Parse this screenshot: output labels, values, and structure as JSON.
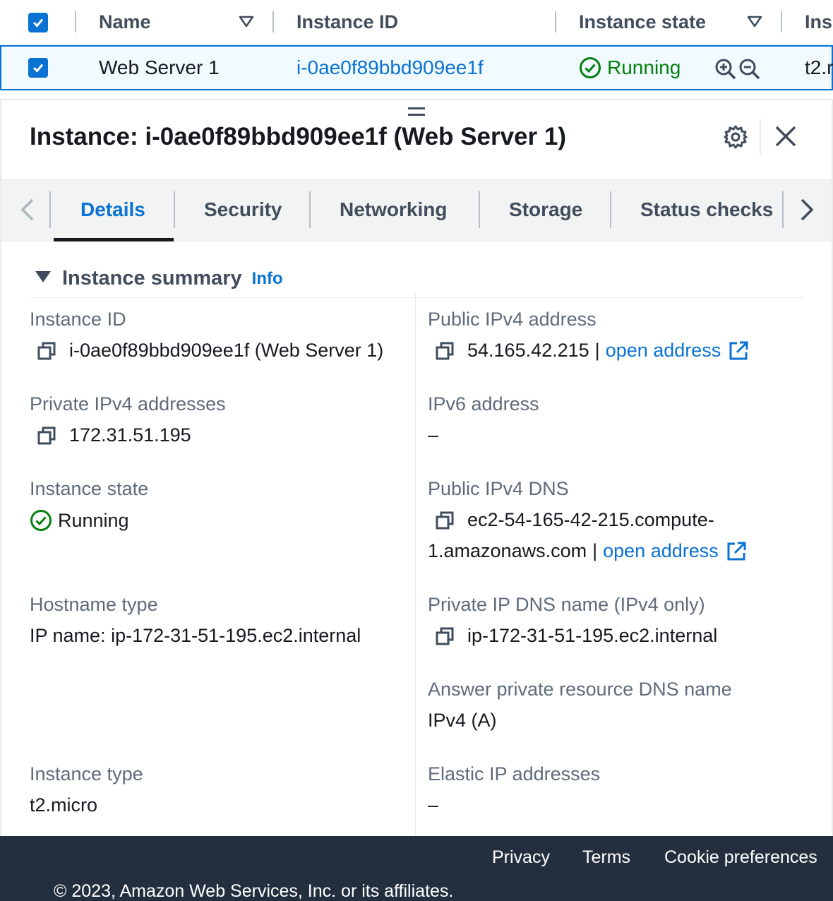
{
  "table": {
    "headers": {
      "name": "Name",
      "instance_id": "Instance ID",
      "instance_state": "Instance state",
      "instance_type_partial": "Ins"
    },
    "row": {
      "name": "Web Server 1",
      "instance_id": "i-0ae0f89bbd909ee1f",
      "state": "Running",
      "type_partial": "t2.r"
    }
  },
  "panel": {
    "title": "Instance: i-0ae0f89bbd909ee1f (Web Server 1)",
    "tabs": [
      "Details",
      "Security",
      "Networking",
      "Storage",
      "Status checks"
    ],
    "active_tab": "Details",
    "section": {
      "title": "Instance summary",
      "info": "Info"
    },
    "fields": {
      "instance_id": {
        "label": "Instance ID",
        "value": "i-0ae0f89bbd909ee1f (Web Server 1)"
      },
      "public_ipv4": {
        "label": "Public IPv4 address",
        "value": "54.165.42.215",
        "sep": "|",
        "link": "open address"
      },
      "private_ipv4": {
        "label": "Private IPv4 addresses",
        "value": "172.31.51.195"
      },
      "ipv6": {
        "label": "IPv6 address",
        "value": "–"
      },
      "instance_state": {
        "label": "Instance state",
        "value": "Running"
      },
      "public_dns": {
        "label": "Public IPv4 DNS",
        "value_line1": "ec2-54-165-42-215.compute-",
        "value_line2": "1.amazonaws.com",
        "sep": "|",
        "link": "open address"
      },
      "hostname_type": {
        "label": "Hostname type",
        "value": "IP name: ip-172-31-51-195.ec2.internal"
      },
      "private_dns": {
        "label": "Private IP DNS name (IPv4 only)",
        "value": "ip-172-31-51-195.ec2.internal"
      },
      "answer_dns": {
        "label": "Answer private resource DNS name",
        "value": "IPv4 (A)"
      },
      "instance_type": {
        "label": "Instance type",
        "value": "t2.micro"
      },
      "elastic_ip": {
        "label": "Elastic IP addresses",
        "value": "–"
      }
    }
  },
  "footer": {
    "links": [
      "Privacy",
      "Terms",
      "Cookie preferences"
    ],
    "copyright": "© 2023, Amazon Web Services, Inc. or its affiliates."
  },
  "colors": {
    "link": "#0972d3",
    "success": "#037f0c",
    "footer_bg": "#232f3e",
    "text": "#16191f",
    "label": "#5f6b7a"
  },
  "icons": [
    "checkbox-checked-icon",
    "sort-filter-icon",
    "status-running-icon",
    "zoom-in-icon",
    "zoom-out-icon",
    "drag-handle-icon",
    "gear-icon",
    "close-icon",
    "chevron-left-icon",
    "chevron-right-icon",
    "caret-down-icon",
    "copy-icon",
    "external-link-icon"
  ]
}
